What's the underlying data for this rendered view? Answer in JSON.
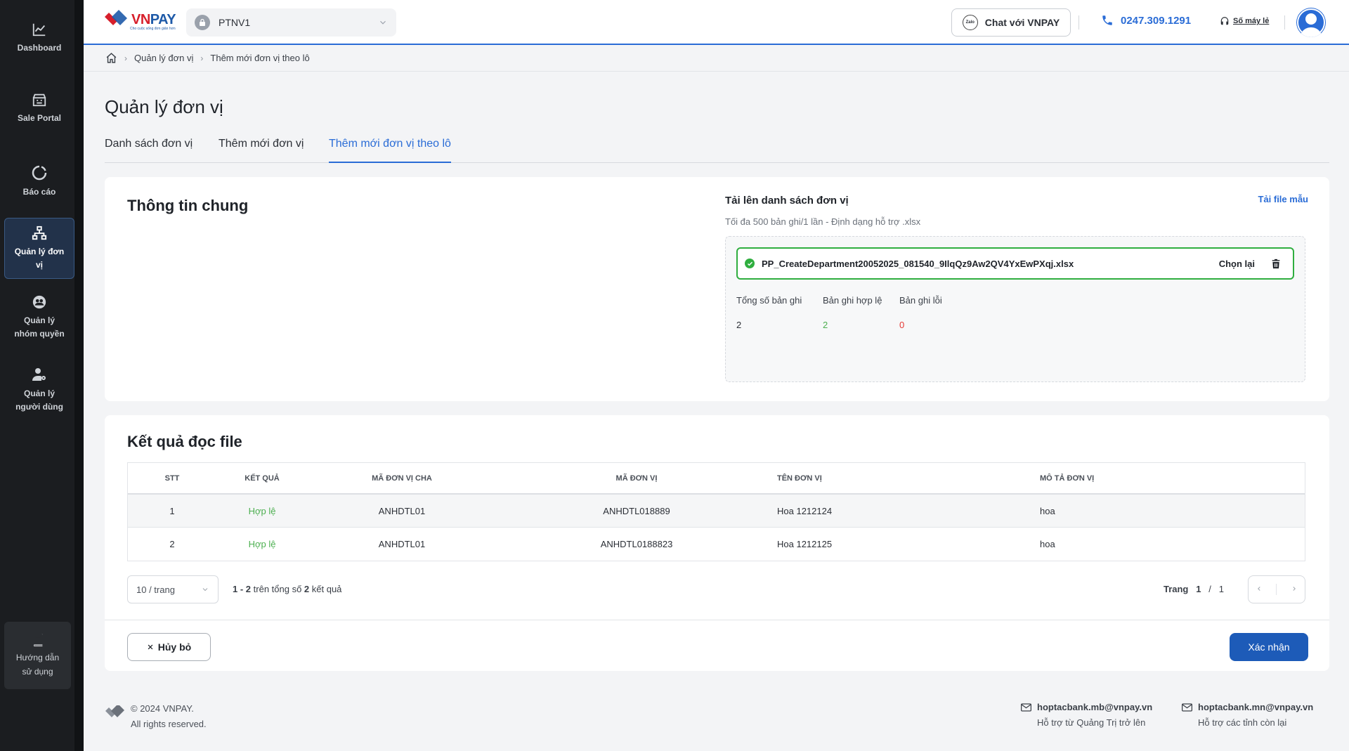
{
  "sidebar": {
    "items": [
      {
        "label": "Dashboard"
      },
      {
        "label": "Sale Portal"
      },
      {
        "label": "Báo cáo"
      },
      {
        "label_line1": "Quản lý đơn",
        "label_line2": "vị"
      },
      {
        "label_line1": "Quản lý",
        "label_line2": "nhóm quyền"
      },
      {
        "label_line1": "Quản lý",
        "label_line2": "người dùng"
      }
    ],
    "guide": {
      "line1": "Hướng dẫn",
      "line2": "sử dụng"
    }
  },
  "header": {
    "logo_main": "VN",
    "logo_accent": "PAY",
    "logo_tagline": "Cho cuộc sống đơn giản hơn",
    "org": "PTNV1",
    "chat_label": "Chat với VNPAY",
    "zalo_text": "Zalo",
    "hotline": "0247.309.1291",
    "ext_label": "Số máy lẻ"
  },
  "breadcrumb": {
    "items": [
      "Quản lý đơn vị",
      "Thêm mới đơn vị theo lô"
    ]
  },
  "page": {
    "title": "Quản lý đơn vị",
    "tabs": [
      "Danh sách đơn vị",
      "Thêm mới đơn vị",
      "Thêm mới đơn vị theo lô"
    ],
    "active_tab": 2
  },
  "general": {
    "title": "Thông tin chung",
    "upload_title": "Tải lên danh sách đơn vị",
    "upload_note": "Tối đa 500 bản ghi/1 lần - Định dạng hỗ trợ .xlsx",
    "template_link": "Tải file mẫu",
    "file_name": "PP_CreateDepartment20052025_081540_9IlqQz9Aw2QV4YxEwPXqj.xlsx",
    "reselect_label": "Chọn lại",
    "stats": {
      "total_label": "Tổng số bản ghi",
      "total": "2",
      "valid_label": "Bản ghi hợp lệ",
      "valid": "2",
      "error_label": "Bản ghi lỗi",
      "error": "0"
    },
    "colors": {
      "success": "#2fae3f",
      "error": "#e53935",
      "primary": "#2a6cd6"
    }
  },
  "result": {
    "title": "Kết quả đọc file",
    "columns": [
      "STT",
      "Kết quả",
      "Mã đơn vị cha",
      "Mã đơn vị",
      "Tên đơn vị",
      "Mô tả đơn vị"
    ],
    "rows": [
      {
        "stt": "1",
        "result": "Hợp lệ",
        "parent": "ANHDTL01",
        "code": "ANHDTL018889",
        "name": "Hoa 1212124",
        "desc": "hoa"
      },
      {
        "stt": "2",
        "result": "Hợp lệ",
        "parent": "ANHDTL01",
        "code": "ANHDTL0188823",
        "name": "Hoa 1212125",
        "desc": "hoa"
      }
    ],
    "pager": {
      "page_size": "10 / trang",
      "range_from": "1",
      "range_dash": " - ",
      "range_to": "2",
      "range_mid": " trên tổng số ",
      "range_total": "2",
      "range_suffix": " kết quả",
      "page_label": "Trang",
      "page_current": "1",
      "page_sep": "/",
      "page_total": "1"
    },
    "cancel_label": "Hủy bỏ",
    "confirm_label": "Xác nhận"
  },
  "footer": {
    "copyright": "© 2024 VNPAY.",
    "rights": "All rights reserved.",
    "contacts": [
      {
        "email": "hoptacbank.mb@vnpay.vn",
        "note": "Hỗ trợ từ Quảng Trị trở lên"
      },
      {
        "email": "hoptacbank.mn@vnpay.vn",
        "note": "Hỗ trợ các tỉnh còn lại"
      }
    ]
  }
}
